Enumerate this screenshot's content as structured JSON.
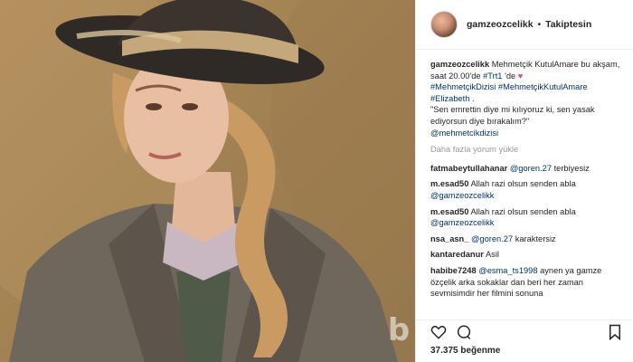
{
  "header": {
    "username": "gamzeozcelikk",
    "separator": "•",
    "follow_status": "Takiptesin"
  },
  "caption": {
    "username": "gamzeozcelikk",
    "text_1": " Mehmetçik KutulAmare bu akşam, saat 20.00'de ",
    "tag_trt": "#Trt1",
    "text_2": " 'de ",
    "heart": "♥",
    "tag_dizi": "#MehmetçikDizisi",
    "tag_kutul": "#MehmetçikKutulAmare",
    "tag_elizabeth": "#Elizabeth",
    "text_3": " .",
    "quote": "\"Sen emrettin diye mi kılıyoruz ki, sen yasak ediyorsun diye bırakalım?\"",
    "mention": "@mehmetcikdizisi"
  },
  "load_more": "Daha fazla yorum yükle",
  "comments": [
    {
      "user": "fatmabeytullahanar",
      "mention": "@goren.27",
      "text": " terbiyesiz"
    },
    {
      "user": "m.esad50",
      "mention": "",
      "text": "Allah razi olsun senden abla"
    },
    {
      "user": "",
      "mention": "@gamzeozcelikk",
      "text": ""
    },
    {
      "user": "m.esad50",
      "mention": "",
      "text": "Allah razi olsun senden abla"
    },
    {
      "user": "",
      "mention": "@gamzeozcelikk",
      "text": ""
    },
    {
      "user": "nsa_asn_",
      "mention": "@goren.27",
      "text": " karaktersiz"
    },
    {
      "user": "kantaredanur",
      "mention": "",
      "text": "Asil"
    },
    {
      "user": "habibe7248",
      "mention": "@esma_ts1998",
      "text": " aynen ya gamze özçelik arka sokaklar dan beri her zaman sevmisimdir her filmini sonuna"
    }
  ],
  "actions": {
    "like_icon": "heart-outline-icon",
    "comment_icon": "comment-bubble-icon",
    "save_icon": "bookmark-icon"
  },
  "likes": {
    "count": "37.375",
    "label": "beğenme"
  },
  "watermark": "b",
  "colors": {
    "link": "#003569",
    "muted": "#999999",
    "heart": "#ed4956",
    "border": "#efefef"
  }
}
